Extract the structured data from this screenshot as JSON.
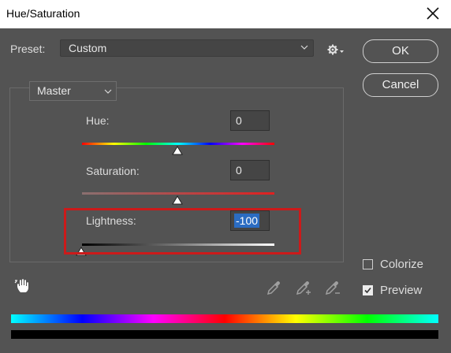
{
  "window": {
    "title": "Hue/Saturation"
  },
  "preset": {
    "label": "Preset:",
    "value": "Custom"
  },
  "buttons": {
    "ok": "OK",
    "cancel": "Cancel"
  },
  "channel": {
    "value": "Master"
  },
  "sliders": {
    "hue": {
      "label": "Hue:",
      "value": "0"
    },
    "saturation": {
      "label": "Saturation:",
      "value": "0"
    },
    "lightness": {
      "label": "Lightness:",
      "value": "-100"
    }
  },
  "options": {
    "colorize": {
      "label": "Colorize",
      "checked": false
    },
    "preview": {
      "label": "Preview",
      "checked": true
    }
  },
  "icons": {
    "close": "close-icon",
    "gear": "gear-icon",
    "hand": "targeted-adjustment-hand-icon",
    "eyedropper": "eyedropper-icon",
    "eyedropper_add": "eyedropper-add-icon",
    "eyedropper_subtract": "eyedropper-subtract-icon"
  },
  "colors": {
    "highlight": "#cc1a1a",
    "selection": "#2b6cc2",
    "background": "#535353"
  }
}
